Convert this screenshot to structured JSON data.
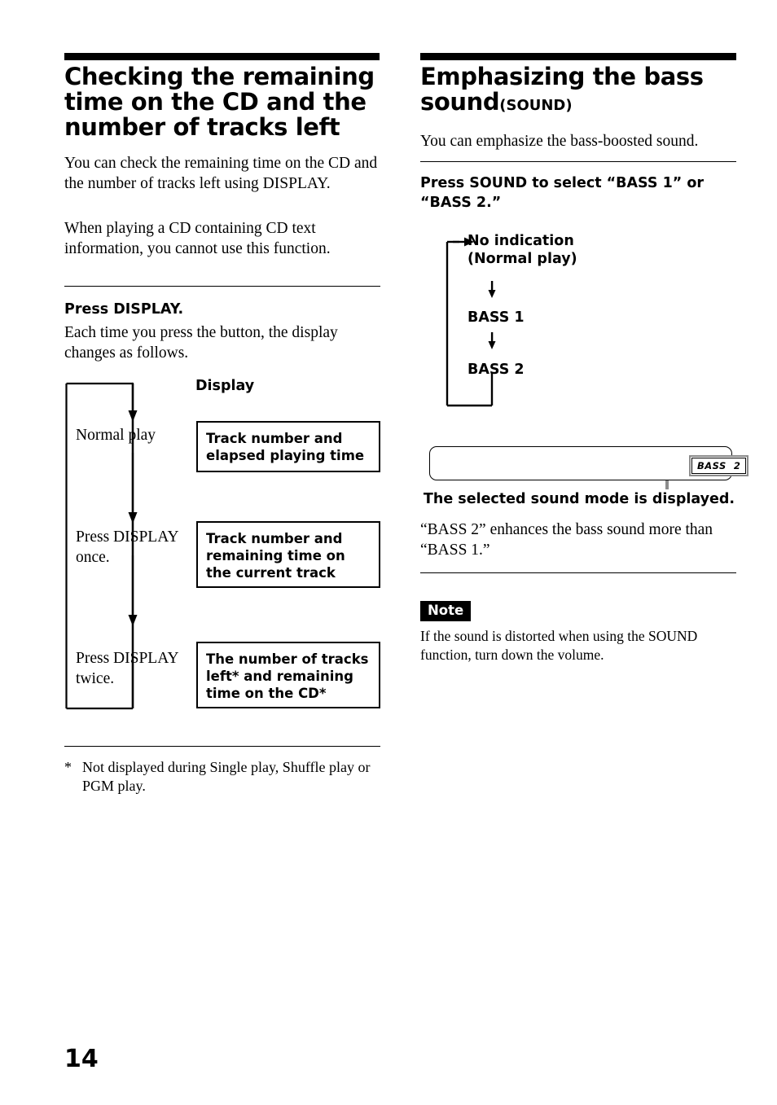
{
  "page": {
    "number": "14"
  },
  "left_column": {
    "heading": "Checking the remaining time on the CD and the number of tracks left",
    "intro_paragraph_1": "You can check the remaining time on the CD and the number of tracks left using DISPLAY.",
    "intro_paragraph_2": "When playing a CD containing CD text information, you cannot use this function.",
    "step_heading": "Press DISPLAY.",
    "step_body": "Each time you press the button, the display changes as follows.",
    "diagram": {
      "column_header": "Display",
      "rows": [
        {
          "action": "Normal play",
          "display": "Track number and elapsed playing time"
        },
        {
          "action": "Press DISPLAY once.",
          "display": "Track number and remaining time on the current track"
        },
        {
          "action": "Press DISPLAY twice.",
          "display": "The number of tracks left* and remaining time on the CD*"
        }
      ]
    },
    "footnote": {
      "mark": "*",
      "text": "Not displayed during Single play, Shuffle play or PGM play."
    }
  },
  "right_column": {
    "heading": "Emphasizing the bass sound",
    "heading_suffix": "(SOUND)",
    "intro": "You can emphasize the bass-boosted sound.",
    "step_heading": "Press SOUND to select “BASS 1” or “BASS 2.”",
    "cycle": {
      "states": [
        "No indication\n(Normal play)",
        "BASS 1",
        "BASS 2"
      ]
    },
    "panel": {
      "indicator_label": "BASS  2",
      "caption": "The selected sound mode is displayed."
    },
    "explanation": "“BASS 2” enhances the bass sound more than “BASS 1.”",
    "note": {
      "badge": "Note",
      "text": "If the sound is distorted when using the SOUND function, turn down the volume."
    }
  }
}
